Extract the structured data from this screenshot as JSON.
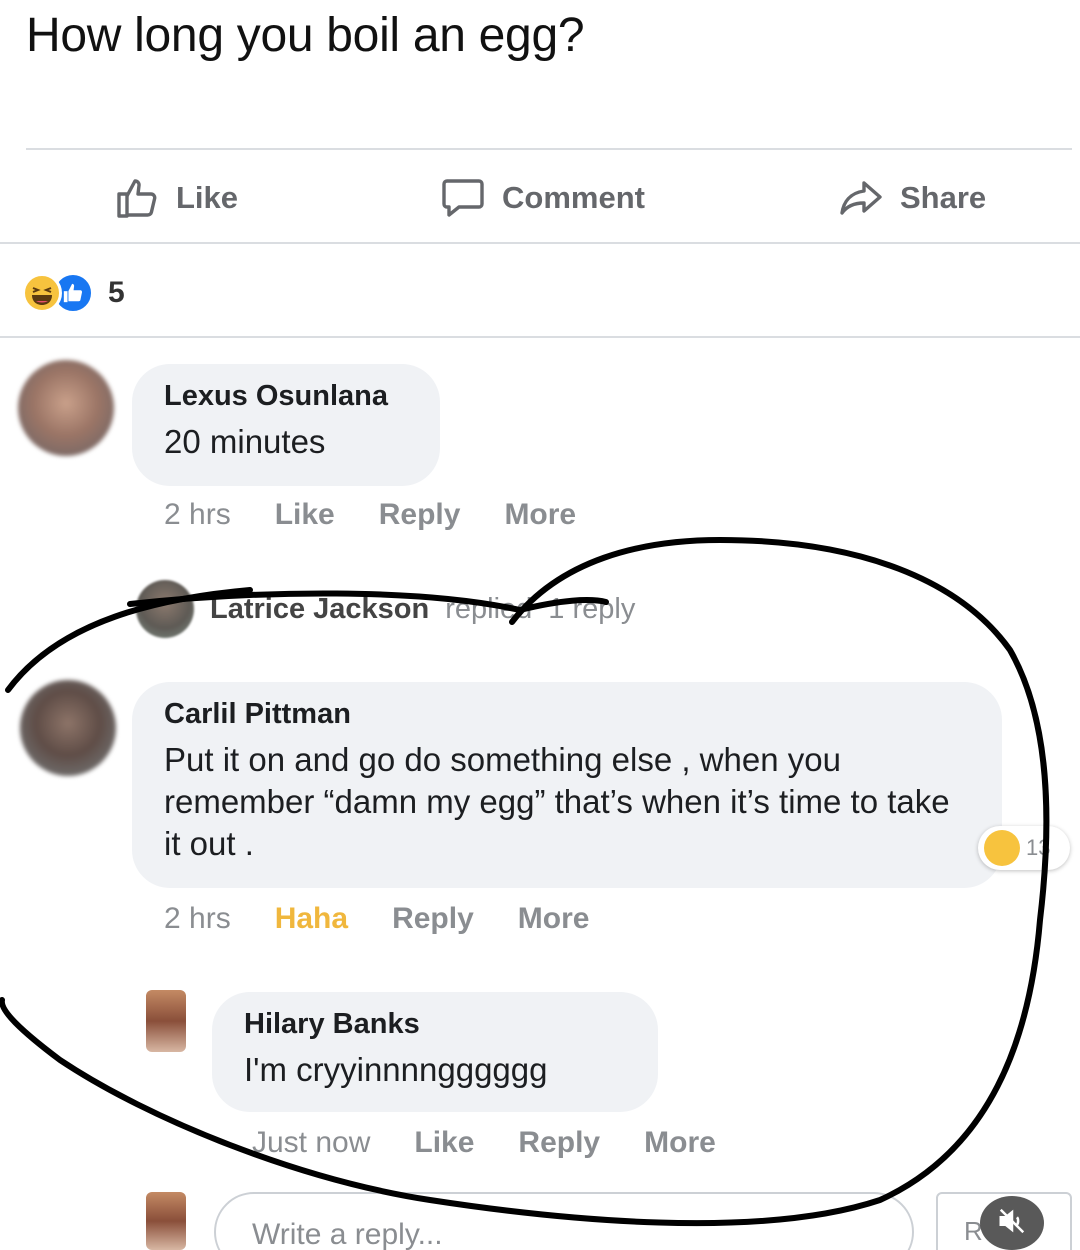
{
  "post": {
    "title": "How long you boil an egg?"
  },
  "actions": {
    "like": "Like",
    "comment": "Comment",
    "share": "Share"
  },
  "reactions": {
    "count": "5",
    "types": [
      "haha-icon",
      "like-icon"
    ]
  },
  "comments": [
    {
      "name": "Lexus Osunlana",
      "text": "20 minutes",
      "time": "2 hrs",
      "like": "Like",
      "reply": "Reply",
      "more": "More"
    },
    {
      "name": "Carlil Pittman",
      "text": "Put it on and go do something else , when you remember “damn my egg” that’s when it’s time to take it out .",
      "time": "2 hrs",
      "like": "Haha",
      "reply": "Reply",
      "more": "More",
      "reaction_count": "13"
    }
  ],
  "reply_summary": {
    "name": "Latrice Jackson",
    "verb": "replied",
    "tail": "1 reply"
  },
  "nested_reply": {
    "name": "Hilary Banks",
    "text": "I'm cryyinnnngggggg",
    "time": "Just now",
    "like": "Like",
    "reply": "Reply",
    "more": "More"
  },
  "composer": {
    "placeholder": "Write a reply...",
    "side_label": "R"
  },
  "colors": {
    "like_blue": "#1877f2",
    "haha_yellow": "#f7c33e",
    "bubble_gray": "#f0f2f5",
    "meta_gray": "#8a8d91"
  }
}
